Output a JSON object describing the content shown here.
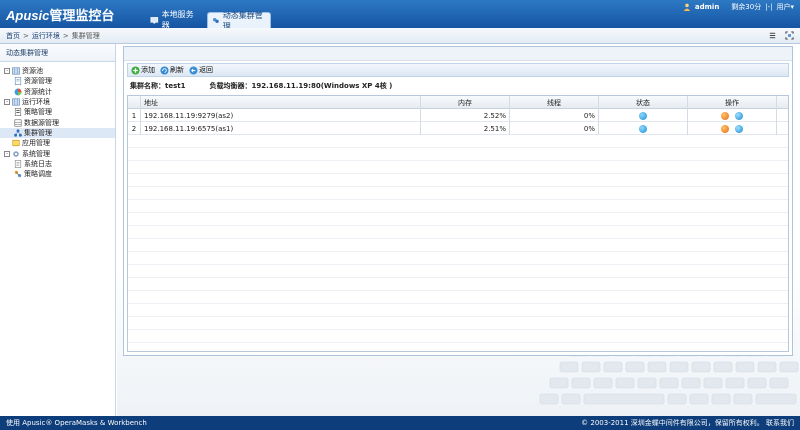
{
  "header": {
    "logo_brand": "Apusic",
    "logo_title": "管理监控台",
    "logo_sub": "",
    "tabs": [
      {
        "label": "本地服务器"
      },
      {
        "label": "动态集群管理"
      }
    ],
    "user": "admin",
    "timeout": "剩余30分",
    "sep": "|-|",
    "user_menu": "用户▾"
  },
  "breadcrumb": {
    "home": "首页",
    "env": "运行环境",
    "current": "集群管理",
    "sep": ">"
  },
  "sidebar": {
    "title": "动态集群管理",
    "nodes": [
      {
        "label": "资源池",
        "level": 0,
        "toggle": "-"
      },
      {
        "label": "资源管理",
        "level": 1
      },
      {
        "label": "资源统计",
        "level": 1
      },
      {
        "label": "运行环境",
        "level": 0,
        "toggle": "-"
      },
      {
        "label": "策略管理",
        "level": 1
      },
      {
        "label": "数据源管理",
        "level": 1
      },
      {
        "label": "集群管理",
        "level": 1,
        "selected": true
      },
      {
        "label": "应用管理",
        "level": 0
      },
      {
        "label": "系统管理",
        "level": 0,
        "toggle": "-"
      },
      {
        "label": "系统日志",
        "level": 1
      },
      {
        "label": "策略调度",
        "level": 1
      }
    ]
  },
  "toolbar": {
    "add": "添加",
    "refresh": "刷新",
    "back": "返回"
  },
  "info": {
    "cluster_label": "集群名称：",
    "cluster_name": "test1",
    "lb_label": "负载均衡器：",
    "lb_value": "192.168.11.19:80(Windows XP 4核 )"
  },
  "grid": {
    "headers": [
      "",
      "地址",
      "内存",
      "线程",
      "状态",
      "操作",
      ""
    ],
    "rows": [
      {
        "idx": "1",
        "addr": "192.168.11.19:9279(as2)",
        "mem": "2.52%",
        "thread": "0%"
      },
      {
        "idx": "2",
        "addr": "192.168.11.19:6575(as1)",
        "mem": "2.51%",
        "thread": "0%"
      }
    ]
  },
  "footer": {
    "left": "使用 Apusic® OperaMasks & Workbench",
    "right": "© 2003-2011 深圳金蝶中间件有限公司，保留所有权利。 联系我们"
  },
  "colors": {
    "header_blue": "#1655a2",
    "footer_blue": "#0d3d7a",
    "selected_bg": "#dde8f6"
  }
}
